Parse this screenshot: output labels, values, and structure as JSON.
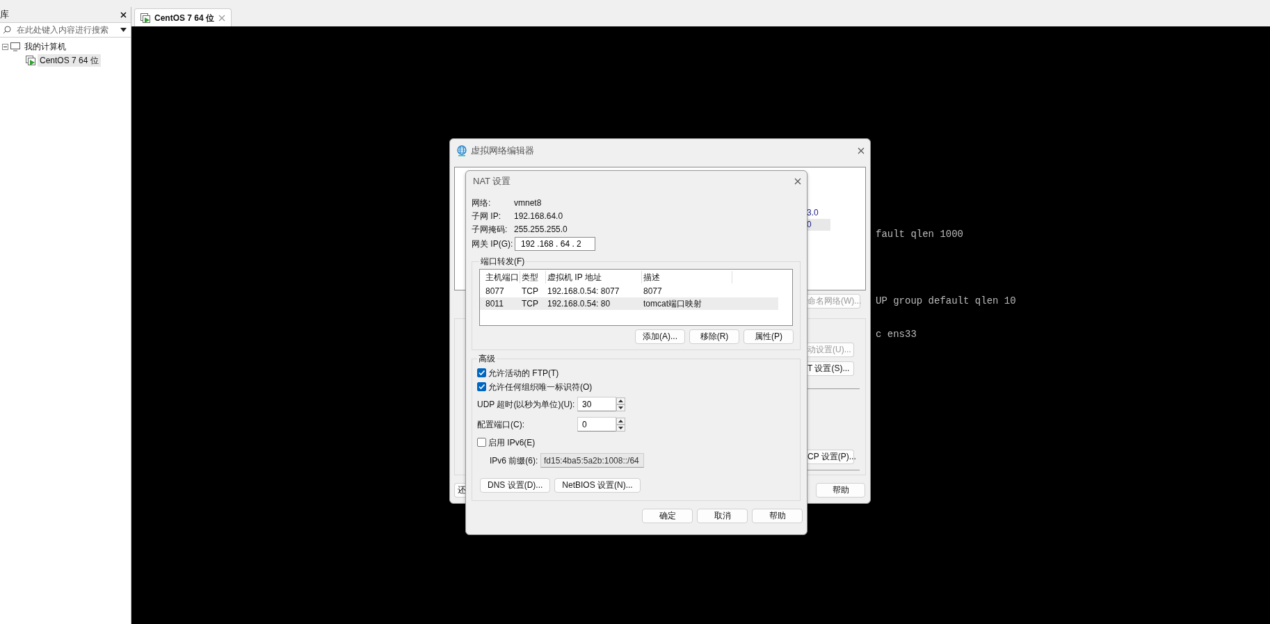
{
  "sidebar": {
    "title": "库",
    "search": {
      "placeholder": "在此处键入内容进行搜索"
    },
    "tree": [
      {
        "label": "我的计算机",
        "expanded": true,
        "children": [
          {
            "label": "CentOS 7 64 位",
            "selected": true
          }
        ]
      }
    ]
  },
  "tabs": [
    {
      "label": "CentOS 7 64 位",
      "selected": true
    }
  ],
  "console": {
    "lines": [
      "fault qlen 1000",
      "UP group default qlen 10",
      "c ens33"
    ]
  },
  "network_editor": {
    "title": "虚拟网络编辑器",
    "list_cells": [
      {
        "text": "3.0",
        "selected": false
      },
      {
        "text": "0",
        "selected": true
      }
    ],
    "rename_button": {
      "label": "命名网络(W)...",
      "disabled": true
    },
    "settings_buttons": [
      {
        "label": "动设置(U)...",
        "disabled": true
      },
      {
        "label": "T 设置(S)...",
        "disabled": false
      },
      {
        "label": "CP 设置(P)...",
        "disabled": false
      }
    ],
    "restore_button": "还",
    "help_button": "帮助"
  },
  "nat_settings": {
    "title": "NAT 设置",
    "info": [
      {
        "label": "网络:",
        "value": "vmnet8"
      },
      {
        "label": "子网 IP:",
        "value": "192.168.64.0"
      },
      {
        "label": "子网掩码:",
        "value": "255.255.255.0"
      }
    ],
    "gateway": {
      "label": "网关 IP(G):",
      "value": "192 .168 . 64 . 2"
    },
    "port_forwarding": {
      "title": "端口转发(F)",
      "columns": [
        "主机端口",
        "类型",
        "虚拟机 IP 地址",
        "描述"
      ],
      "rows": [
        {
          "cells": [
            "8077",
            "TCP",
            "192.168.0.54: 8077",
            "8077"
          ],
          "selected": false
        },
        {
          "cells": [
            "8011",
            "TCP",
            "192.168.0.54: 80",
            "tomcat端口映射"
          ],
          "selected": true
        }
      ],
      "buttons": [
        "添加(A)...",
        "移除(R)",
        "属性(P)"
      ]
    },
    "advanced": {
      "title": "高级",
      "checkboxes": [
        {
          "label": "允许活动的 FTP(T)",
          "checked": true
        },
        {
          "label": "允许任何组织唯一标识符(O)",
          "checked": true
        }
      ],
      "spinners": [
        {
          "label": "UDP 超时(以秒为单位)(U):",
          "value": "30"
        },
        {
          "label": "配置端口(C):",
          "value": "0"
        }
      ],
      "ipv6": {
        "label": "启用 IPv6(E)",
        "checked": false
      },
      "ipv6_prefix": {
        "label": "IPv6 前缀(6):",
        "value": "fd15:4ba5:5a2b:1008::/64",
        "disabled": true
      },
      "buttons": [
        "DNS 设置(D)...",
        "NetBIOS 设置(N)..."
      ]
    },
    "buttons": [
      "确定",
      "取消",
      "帮助"
    ]
  }
}
